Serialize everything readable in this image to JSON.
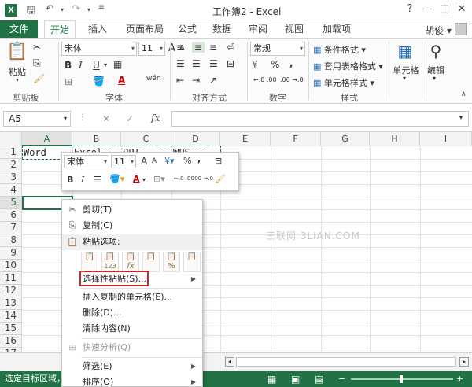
{
  "window": {
    "title": "工作簿2 - Excel",
    "app_letter": "X",
    "qat": {
      "save_icon": "save-icon",
      "undo_icon": "undo-icon",
      "redo_icon": "redo-icon"
    },
    "controls": {
      "help": "?",
      "min": "—",
      "max": "□",
      "close": "✕"
    }
  },
  "tabs": {
    "file": "文件",
    "items": [
      "开始",
      "插入",
      "页面布局",
      "公式",
      "数据",
      "审阅",
      "视图",
      "加载项"
    ],
    "active": "开始",
    "user": "胡俊"
  },
  "ribbon": {
    "clipboard": {
      "label": "剪贴板",
      "paste": "粘贴"
    },
    "font": {
      "label": "字体",
      "name": "宋体",
      "size": "11",
      "bold": "B",
      "italic": "I",
      "underline": "U",
      "grow": "A",
      "shrink": "A",
      "phonetic": "wén"
    },
    "alignment": {
      "label": "对齐方式"
    },
    "number": {
      "label": "数字",
      "format": "常规",
      "percent": "%",
      "comma": ",",
      "inc": "←.0 .00",
      "dec": ".00 →.0",
      "currency": "¥"
    },
    "styles": {
      "label": "样式",
      "conditional": "条件格式",
      "table": "套用表格格式",
      "cell": "单元格样式"
    },
    "cells": {
      "label": "单元格"
    },
    "editing": {
      "label": "编辑"
    }
  },
  "formula_bar": {
    "name_box": "A5",
    "cancel": "✕",
    "enter": "✓",
    "fx": "fx",
    "formula": ""
  },
  "grid": {
    "columns": [
      "A",
      "B",
      "C",
      "D",
      "E",
      "F",
      "G",
      "H",
      "I"
    ],
    "rows": [
      "1",
      "2",
      "3",
      "4",
      "5",
      "6",
      "7",
      "8",
      "9",
      "10",
      "11",
      "12",
      "13",
      "14",
      "15",
      "16",
      "17"
    ],
    "row1": [
      "Word",
      "Excel",
      "PPT",
      "WPS"
    ],
    "selected_cell": "A5"
  },
  "mini_toolbar": {
    "font": "宋体",
    "size": "11",
    "grow": "A",
    "shrink": "A",
    "percent": "%",
    "comma": ",",
    "bold": "B",
    "italic": "I",
    "inc": "←.0 .00",
    "dec": ".00 →.0"
  },
  "context_menu": {
    "cut": "剪切(T)",
    "copy": "复制(C)",
    "paste_options": "粘贴选项:",
    "paste_opts": [
      "",
      "123",
      "fx",
      "",
      "%",
      ""
    ],
    "paste_special": "选择性粘贴(S)...",
    "insert_copied": "插入复制的单元格(E)...",
    "delete": "删除(D)...",
    "clear": "清除内容(N)",
    "quick_analysis": "快速分析(Q)",
    "filter": "筛选(E)",
    "sort": "排序(O)"
  },
  "status": {
    "text": "选定目标区域，"
  },
  "watermark": "三联网 3LIAN.COM",
  "colors": {
    "brand": "#217346",
    "highlight": "#c8282e"
  }
}
